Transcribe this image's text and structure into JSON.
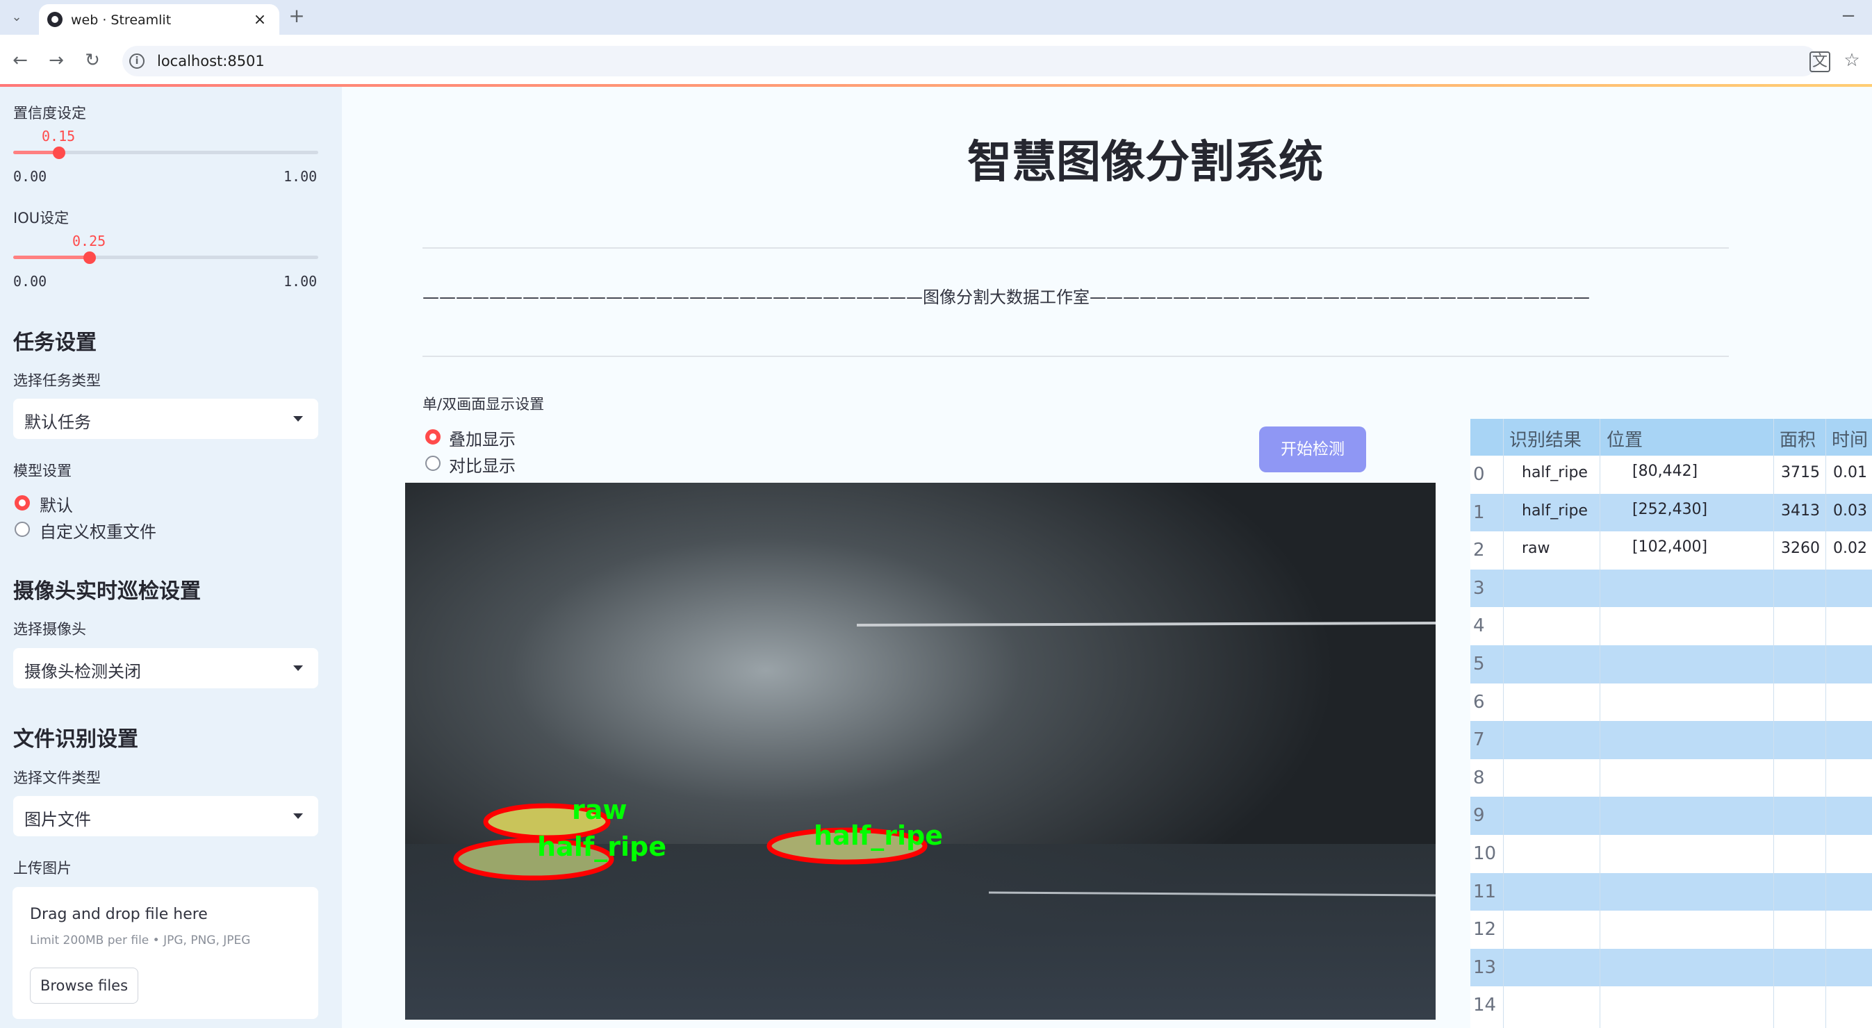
{
  "browser": {
    "tab_title": "web · Streamlit",
    "url": "localhost:8501"
  },
  "sidebar": {
    "confidence": {
      "label": "置信度设定",
      "value": "0.15",
      "min": "0.00",
      "max": "1.00",
      "fraction": 0.15
    },
    "iou": {
      "label": "IOU设定",
      "value": "0.25",
      "min": "0.00",
      "max": "1.00",
      "fraction": 0.25
    },
    "task_heading": "任务设置",
    "task_type_label": "选择任务类型",
    "task_type_value": "默认任务",
    "model_label": "模型设置",
    "model_options": [
      "默认",
      "自定义权重文件"
    ],
    "camera_heading": "摄像头实时巡检设置",
    "camera_label": "选择摄像头",
    "camera_value": "摄像头检测关闭",
    "file_heading": "文件识别设置",
    "file_type_label": "选择文件类型",
    "file_type_value": "图片文件",
    "upload_label": "上传图片",
    "upload_drop": "Drag and drop file here",
    "upload_limit": "Limit 200MB per file • JPG, PNG, JPEG",
    "browse_label": "Browse files"
  },
  "main": {
    "title": "智慧图像分割系统",
    "divider_text": "——————————————————————————————图像分割大数据工作室——————————————————————————————",
    "display_label": "单/双画面显示设置",
    "display_options": [
      "叠加显示",
      "对比显示"
    ],
    "start_button": "开始检测",
    "detections": [
      {
        "label": "raw"
      },
      {
        "label": "half_ripe"
      },
      {
        "label": "half_ripe"
      }
    ]
  },
  "table": {
    "headers": [
      "识别结果",
      "位置",
      "面积",
      "时间"
    ],
    "rows": [
      {
        "idx": "0",
        "result": "half_ripe",
        "position": "[80,442]",
        "area": "3715",
        "time": "0.01"
      },
      {
        "idx": "1",
        "result": "half_ripe",
        "position": "[252,430]",
        "area": "3413",
        "time": "0.03"
      },
      {
        "idx": "2",
        "result": "raw",
        "position": "[102,400]",
        "area": "3260",
        "time": "0.02"
      },
      {
        "idx": "3"
      },
      {
        "idx": "4"
      },
      {
        "idx": "5"
      },
      {
        "idx": "6"
      },
      {
        "idx": "7"
      },
      {
        "idx": "8"
      },
      {
        "idx": "9"
      },
      {
        "idx": "10"
      },
      {
        "idx": "11"
      },
      {
        "idx": "12"
      },
      {
        "idx": "13"
      },
      {
        "idx": "14"
      }
    ]
  },
  "colors": {
    "accent": "#ff4b4b",
    "button": "#8f97f4",
    "sidebar_bg": "#e9f2fa",
    "table_header": "#a8d4f5",
    "table_stripe": "#bcdcf7",
    "mask_outline": "#ff0000",
    "mask_label": "#00ff00"
  },
  "icons": [
    "chevron-down-icon",
    "streamlit-logo-icon",
    "close-icon",
    "plus-icon",
    "back-icon",
    "forward-icon",
    "reload-icon",
    "info-icon",
    "translate-icon",
    "star-icon",
    "minimize-icon"
  ]
}
